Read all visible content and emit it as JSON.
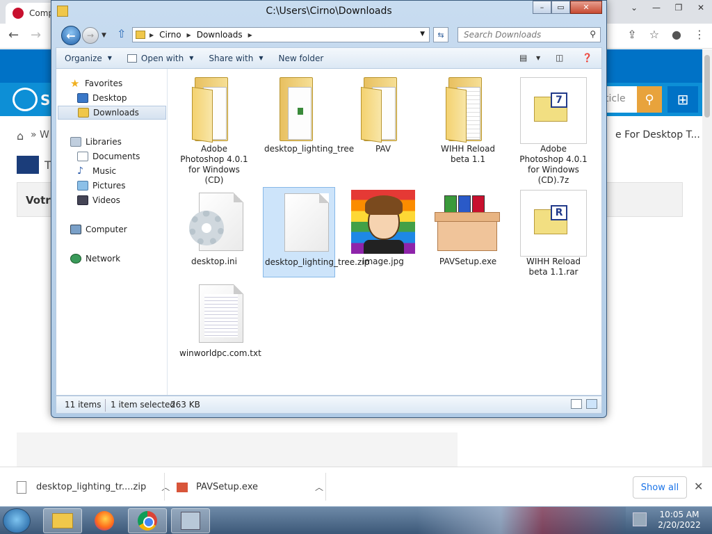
{
  "browser": {
    "tab_title": "Comp",
    "tab2_title": "",
    "window_controls": [
      "—",
      "❐",
      "✕"
    ],
    "site": {
      "logo_text": "So",
      "search_placeholder": "ticle",
      "breadcrumb_right": "e For Desktop T...",
      "breadcrumb_left": "» W",
      "title_left": "T",
      "box_text": "Votre"
    }
  },
  "downloads_shelf": {
    "items": [
      {
        "name": "desktop_lighting_tr....zip"
      },
      {
        "name": "PAVSetup.exe"
      }
    ],
    "show_all": "Show all",
    "close": "✕"
  },
  "explorer": {
    "title": "C:\\Users\\Cirno\\Downloads",
    "window_controls": {
      "min": "–",
      "max": "▭",
      "close": "✕"
    },
    "address": {
      "segments": [
        "Cirno",
        "Downloads"
      ]
    },
    "search_placeholder": "Search Downloads",
    "commands": {
      "organize": "Organize",
      "open_with": "Open with",
      "share_with": "Share with",
      "new_folder": "New folder"
    },
    "nav_pane": {
      "favorites": "Favorites",
      "desktop": "Desktop",
      "downloads": "Downloads",
      "libraries": "Libraries",
      "documents": "Documents",
      "music": "Music",
      "pictures": "Pictures",
      "videos": "Videos",
      "computer": "Computer",
      "network": "Network"
    },
    "files": [
      {
        "label": "Adobe Photoshop 4.0.1 for Windows (CD)",
        "kind": "folder"
      },
      {
        "label": "desktop_lighting_tree",
        "kind": "folder"
      },
      {
        "label": "PAV",
        "kind": "folder"
      },
      {
        "label": "WIHH Reload beta 1.1",
        "kind": "folder"
      },
      {
        "label": "Adobe Photoshop 4.0.1 for Windows (CD).7z",
        "kind": "7z",
        "letter": "7"
      },
      {
        "label": "desktop.ini",
        "kind": "ini"
      },
      {
        "label": "desktop_lighting_tree.zip",
        "kind": "zip",
        "selected": true
      },
      {
        "label": "image.jpg",
        "kind": "image"
      },
      {
        "label": "PAVSetup.exe",
        "kind": "exe"
      },
      {
        "label": "WIHH Reload beta 1.1.rar",
        "kind": "rar",
        "letter": "R"
      },
      {
        "label": "winworldpc.com.txt",
        "kind": "txt"
      }
    ],
    "status": {
      "count": "11 items",
      "selected": "1 item selected",
      "size": "263 KB"
    }
  },
  "taskbar": {
    "time": "10:05 AM",
    "date": "2/20/2022"
  }
}
